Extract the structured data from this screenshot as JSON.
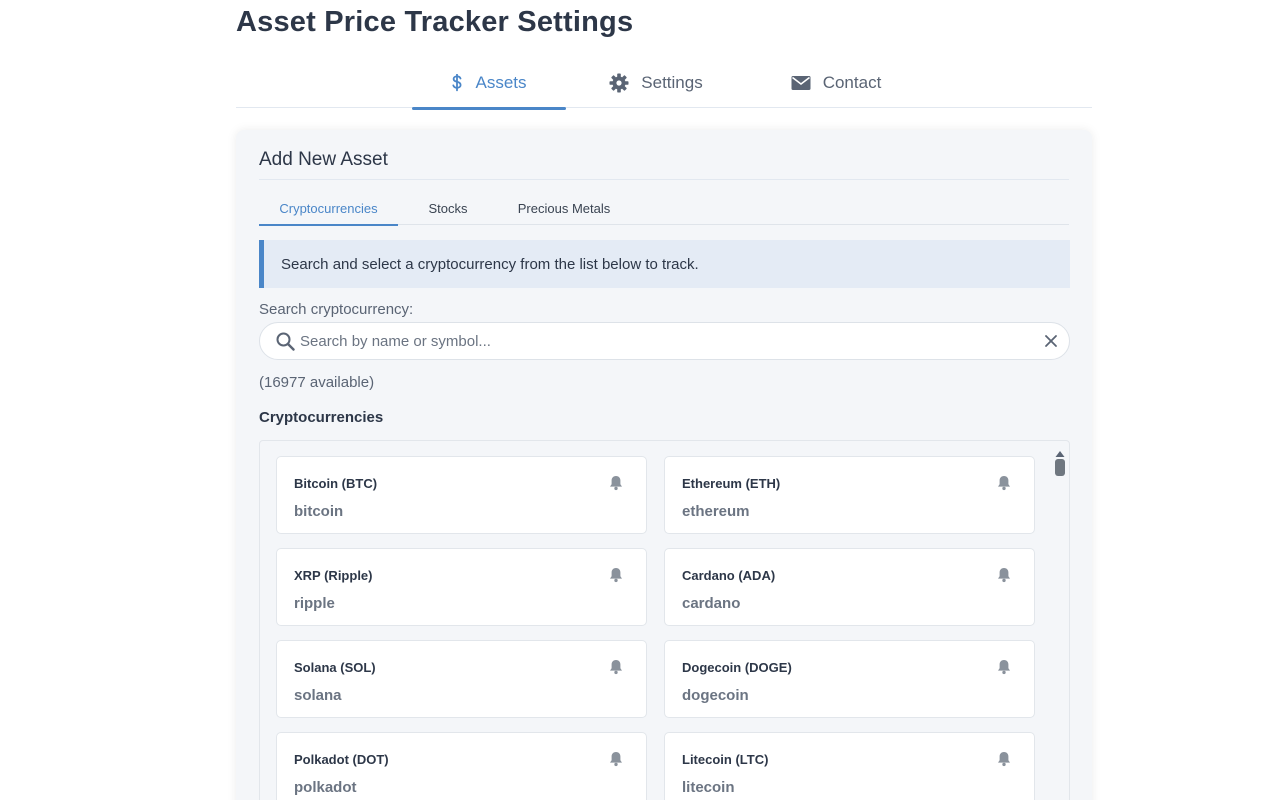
{
  "page": {
    "title": "Asset Price Tracker Settings"
  },
  "main_tabs": [
    {
      "label": "Assets",
      "icon": "dollar-icon",
      "active": true
    },
    {
      "label": "Settings",
      "icon": "gear-icon",
      "active": false
    },
    {
      "label": "Contact",
      "icon": "envelope-icon",
      "active": false
    }
  ],
  "add_asset": {
    "title": "Add New Asset",
    "sub_tabs": [
      {
        "label": "Cryptocurrencies",
        "active": true
      },
      {
        "label": "Stocks",
        "active": false
      },
      {
        "label": "Precious Metals",
        "active": false
      }
    ],
    "info": "Search and select a cryptocurrency from the list below to track.",
    "search": {
      "label": "Search cryptocurrency:",
      "placeholder": "Search by name or symbol...",
      "value": ""
    },
    "available": "(16977 available)",
    "list_heading": "Cryptocurrencies",
    "assets": [
      {
        "name": "Bitcoin (BTC)",
        "id": "bitcoin"
      },
      {
        "name": "Ethereum (ETH)",
        "id": "ethereum"
      },
      {
        "name": "XRP (Ripple)",
        "id": "ripple"
      },
      {
        "name": "Cardano (ADA)",
        "id": "cardano"
      },
      {
        "name": "Solana (SOL)",
        "id": "solana"
      },
      {
        "name": "Dogecoin (DOGE)",
        "id": "dogecoin"
      },
      {
        "name": "Polkadot (DOT)",
        "id": "polkadot"
      },
      {
        "name": "Litecoin (LTC)",
        "id": "litecoin"
      }
    ]
  },
  "colors": {
    "accent": "#4a86c8",
    "text": "#2d3748",
    "muted": "#6b7482",
    "card_bg": "#f4f6f9",
    "info_bg": "#e4ebf5"
  }
}
